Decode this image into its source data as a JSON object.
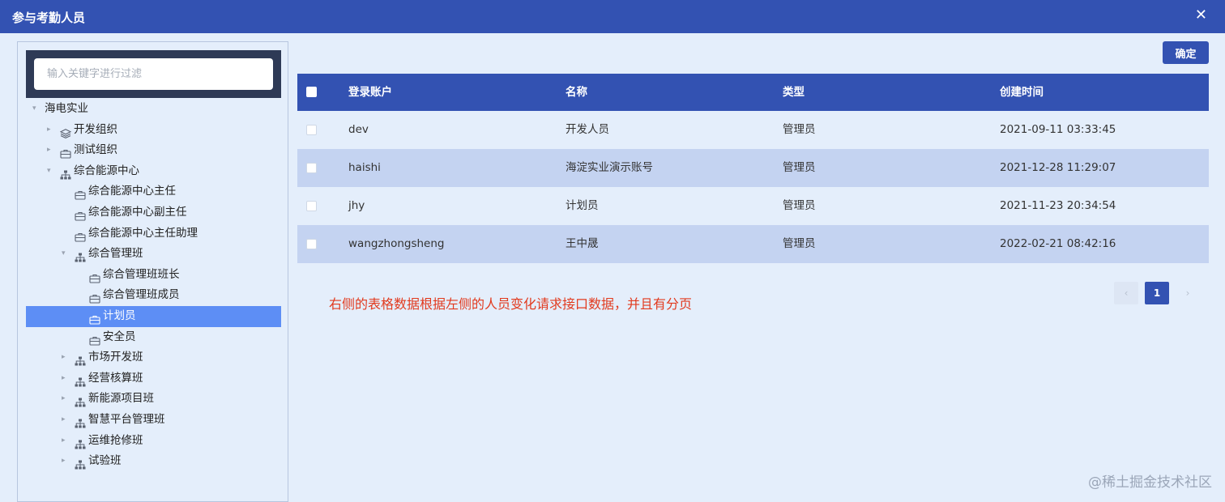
{
  "dialog": {
    "title": "参与考勤人员",
    "close_glyph": "✕",
    "confirm_label": "确定"
  },
  "filter": {
    "placeholder": "输入关键字进行过滤"
  },
  "tree": [
    {
      "label": "海电实业",
      "level": 0,
      "expanded": true,
      "icon": "none",
      "name": "tree-node-haidian"
    },
    {
      "label": "开发组织",
      "level": 1,
      "expanded": false,
      "icon": "layers-icon",
      "name": "tree-node-dev-org"
    },
    {
      "label": "测试组织",
      "level": 1,
      "expanded": false,
      "icon": "briefcase-icon",
      "name": "tree-node-test-org"
    },
    {
      "label": "综合能源中心",
      "level": 1,
      "expanded": true,
      "icon": "org-chart-icon",
      "name": "tree-node-energy-center"
    },
    {
      "label": "综合能源中心主任",
      "level": 2,
      "leaf": true,
      "icon": "briefcase-icon",
      "name": "tree-node-energy-director"
    },
    {
      "label": "综合能源中心副主任",
      "level": 2,
      "leaf": true,
      "icon": "briefcase-icon",
      "name": "tree-node-energy-deputy"
    },
    {
      "label": "综合能源中心主任助理",
      "level": 2,
      "leaf": true,
      "icon": "briefcase-icon",
      "name": "tree-node-energy-assistant"
    },
    {
      "label": "综合管理班",
      "level": 2,
      "expanded": true,
      "icon": "org-chart-icon",
      "name": "tree-node-admin-team"
    },
    {
      "label": "综合管理班班长",
      "level": 3,
      "leaf": true,
      "icon": "briefcase-icon",
      "name": "tree-node-admin-leader"
    },
    {
      "label": "综合管理班成员",
      "level": 3,
      "leaf": true,
      "icon": "briefcase-icon",
      "name": "tree-node-admin-member"
    },
    {
      "label": "计划员",
      "level": 3,
      "leaf": true,
      "icon": "briefcase-icon",
      "selected": true,
      "name": "tree-node-planner"
    },
    {
      "label": "安全员",
      "level": 3,
      "leaf": true,
      "icon": "briefcase-icon",
      "name": "tree-node-safety"
    },
    {
      "label": "市场开发班",
      "level": 2,
      "expanded": false,
      "icon": "org-chart-icon",
      "name": "tree-node-market"
    },
    {
      "label": "经营核算班",
      "level": 2,
      "expanded": false,
      "icon": "org-chart-icon",
      "name": "tree-node-accounting"
    },
    {
      "label": "新能源项目班",
      "level": 2,
      "expanded": false,
      "icon": "org-chart-icon",
      "name": "tree-node-new-energy"
    },
    {
      "label": "智慧平台管理班",
      "level": 2,
      "expanded": false,
      "icon": "org-chart-icon",
      "name": "tree-node-smart-platform"
    },
    {
      "label": "运维抢修班",
      "level": 2,
      "expanded": false,
      "icon": "org-chart-icon",
      "name": "tree-node-maintenance"
    },
    {
      "label": "试验班",
      "level": 2,
      "expanded": false,
      "icon": "org-chart-icon",
      "name": "tree-node-test-team"
    }
  ],
  "table": {
    "columns": [
      "登录账户",
      "名称",
      "类型",
      "创建时间"
    ],
    "rows": [
      [
        "dev",
        "开发人员",
        "管理员",
        "2021-09-11 03:33:45"
      ],
      [
        "haishi",
        "海淀实业演示账号",
        "管理员",
        "2021-12-28 11:29:07"
      ],
      [
        "jhy",
        "计划员",
        "管理员",
        "2021-11-23 20:34:54"
      ],
      [
        "wangzhongsheng",
        "王中晟",
        "管理员",
        "2022-02-21 08:42:16"
      ]
    ]
  },
  "note": "右侧的表格数据根据左侧的人员变化请求接口数据，并且有分页",
  "pagination": {
    "prev": "‹",
    "current": "1",
    "next": "›"
  },
  "watermark": "@稀土掘金技术社区",
  "colors": {
    "accent": "#3352b2",
    "selected": "#5d8ef5",
    "note": "#e23a1e"
  }
}
